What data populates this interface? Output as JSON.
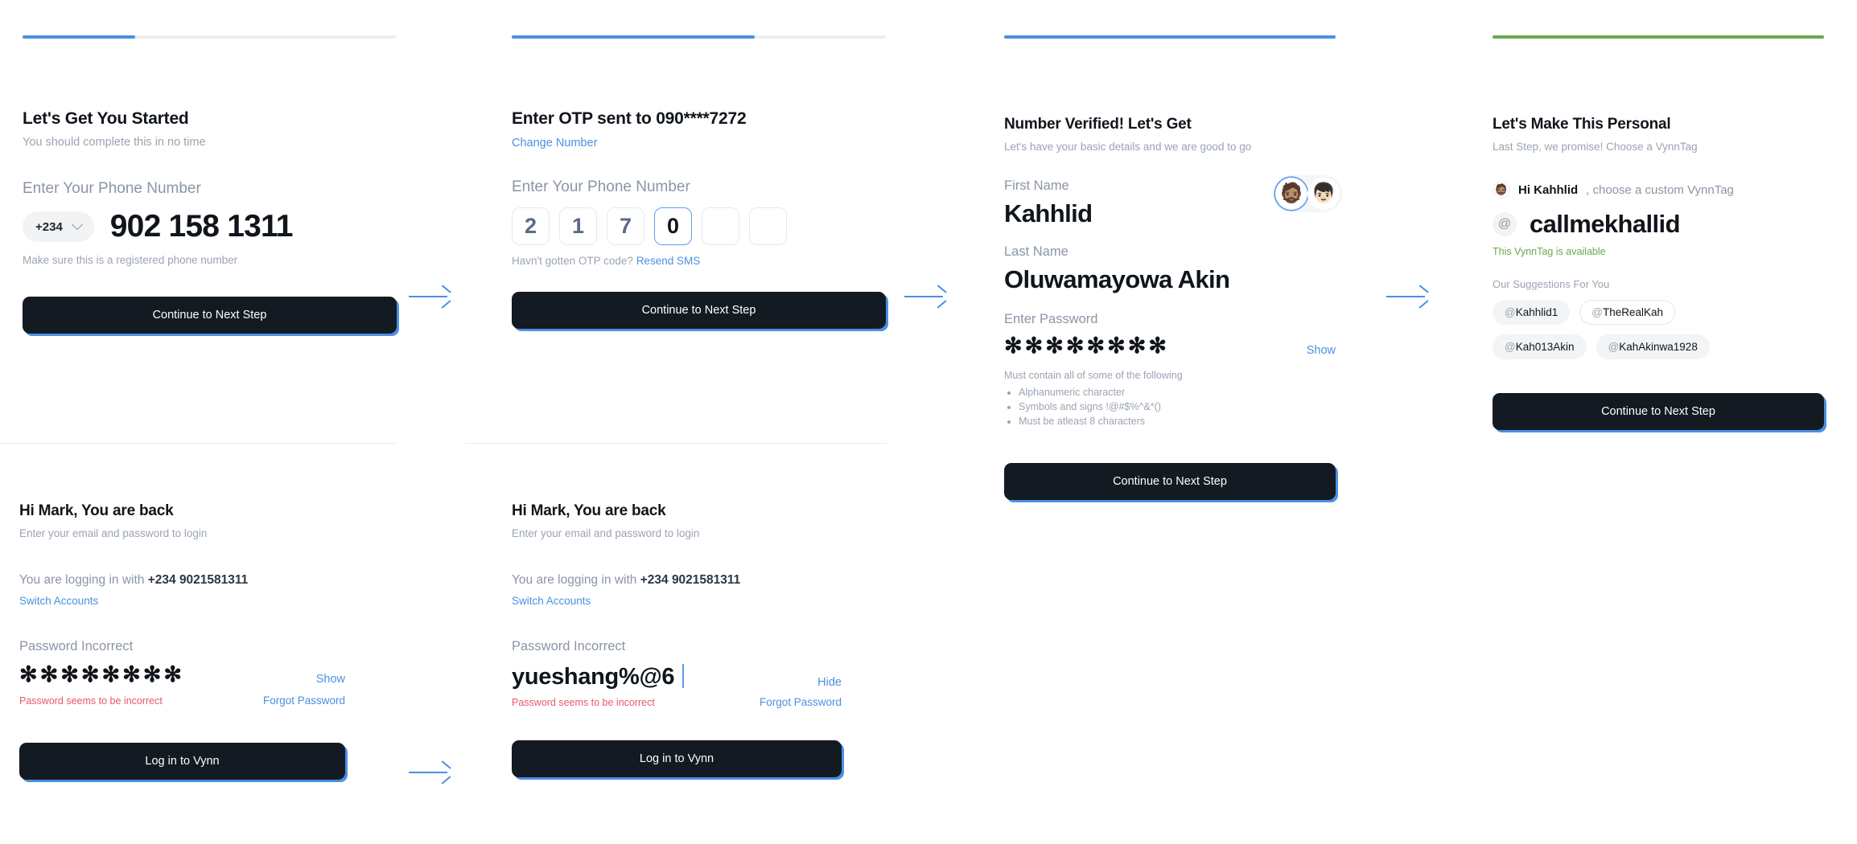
{
  "meta": {
    "brand_blue": "#4a90e2",
    "brand_green": "#6aa84f",
    "dark_button": "#141a21",
    "error_red": "#e8566f"
  },
  "panels": {
    "signup_phone": {
      "progress_percent": 30,
      "title": "Let's Get You Started",
      "subtitle": "You should complete this in no time",
      "field_label": "Enter Your Phone Number",
      "country_code": "+234",
      "phone_value": "902 158 1311",
      "hint": "Make sure this is a registered phone number",
      "cta": "Continue to Next Step"
    },
    "otp": {
      "progress_percent": 65,
      "title": "Enter OTP sent to 090****7272",
      "change_number_link": "Change Number",
      "field_label": "Enter Your Phone Number",
      "digits": [
        "2",
        "1",
        "7",
        "0",
        "",
        ""
      ],
      "active_index": 3,
      "resend_prefix": "Havn't gotten OTP code?",
      "resend_link": "Resend SMS",
      "cta": "Continue to Next Step"
    },
    "details": {
      "progress_percent": 100,
      "title": "Number Verified! Let's Get",
      "subtitle": "Let's have your basic details and we are good to go",
      "first_name_label": "First Name",
      "first_name_value": "Kahhlid",
      "last_name_label": "Last Name",
      "last_name_value": "Oluwamayowa Akin",
      "avatars": [
        "🧔🏽",
        "👦🏻"
      ],
      "avatar_selected_index": 0,
      "password_label": "Enter Password",
      "password_masked": "✻✻✻✻✻✻✻✻",
      "show_toggle": "Show",
      "rules_title": "Must contain all of some of the following",
      "rules": [
        "Alphanumeric character",
        "Symbols and signs !@#$%^&*()",
        "Must be atleast 8 characters"
      ],
      "cta": "Continue to Next Step"
    },
    "vynntag": {
      "progress_percent": 100,
      "progress_color": "#6aa84f",
      "title": "Let's Make This Personal",
      "subtitle": "Last Step, we promise! Choose a VynnTag",
      "greeting_avatar": "🧔🏽",
      "greeting_strong": "Hi Kahhlid",
      "greeting_rest": ", choose a custom VynnTag",
      "at_symbol": "@",
      "tag_value": "callmekhallid",
      "availability": "This VynnTag is available",
      "suggestions_title": "Our Suggestions For You",
      "suggestions": [
        {
          "at": "@",
          "name": "Kahhlid1",
          "style": "filled"
        },
        {
          "at": "@",
          "name": "TheRealKah",
          "style": "outline"
        },
        {
          "at": "@",
          "name": "Kah013Akin",
          "style": "filled"
        },
        {
          "at": "@",
          "name": "KahAkinwa1928",
          "style": "filled"
        }
      ],
      "cta": "Continue to Next Step"
    },
    "login_masked": {
      "title": "Hi Mark, You are back",
      "subtitle": "Enter your email and password to login",
      "logging_prefix": "You are logging in with",
      "logging_number": "+234 9021581311",
      "switch_link": "Switch Accounts",
      "password_label": "Password Incorrect",
      "password_value": "✻✻✻✻✻✻✻✻",
      "toggle": "Show",
      "error": "Password seems to be incorrect",
      "forgot_link": "Forgot Password",
      "cta": "Log in to Vynn"
    },
    "login_visible": {
      "title": "Hi Mark, You are back",
      "subtitle": "Enter your email and password to login",
      "logging_prefix": "You are logging in with",
      "logging_number": "+234 9021581311",
      "switch_link": "Switch Accounts",
      "password_label": "Password Incorrect",
      "password_value": "yueshang%@6",
      "toggle": "Hide",
      "error": "Password seems to be incorrect",
      "forgot_link": "Forgot Password",
      "cta": "Log in to Vynn"
    }
  }
}
